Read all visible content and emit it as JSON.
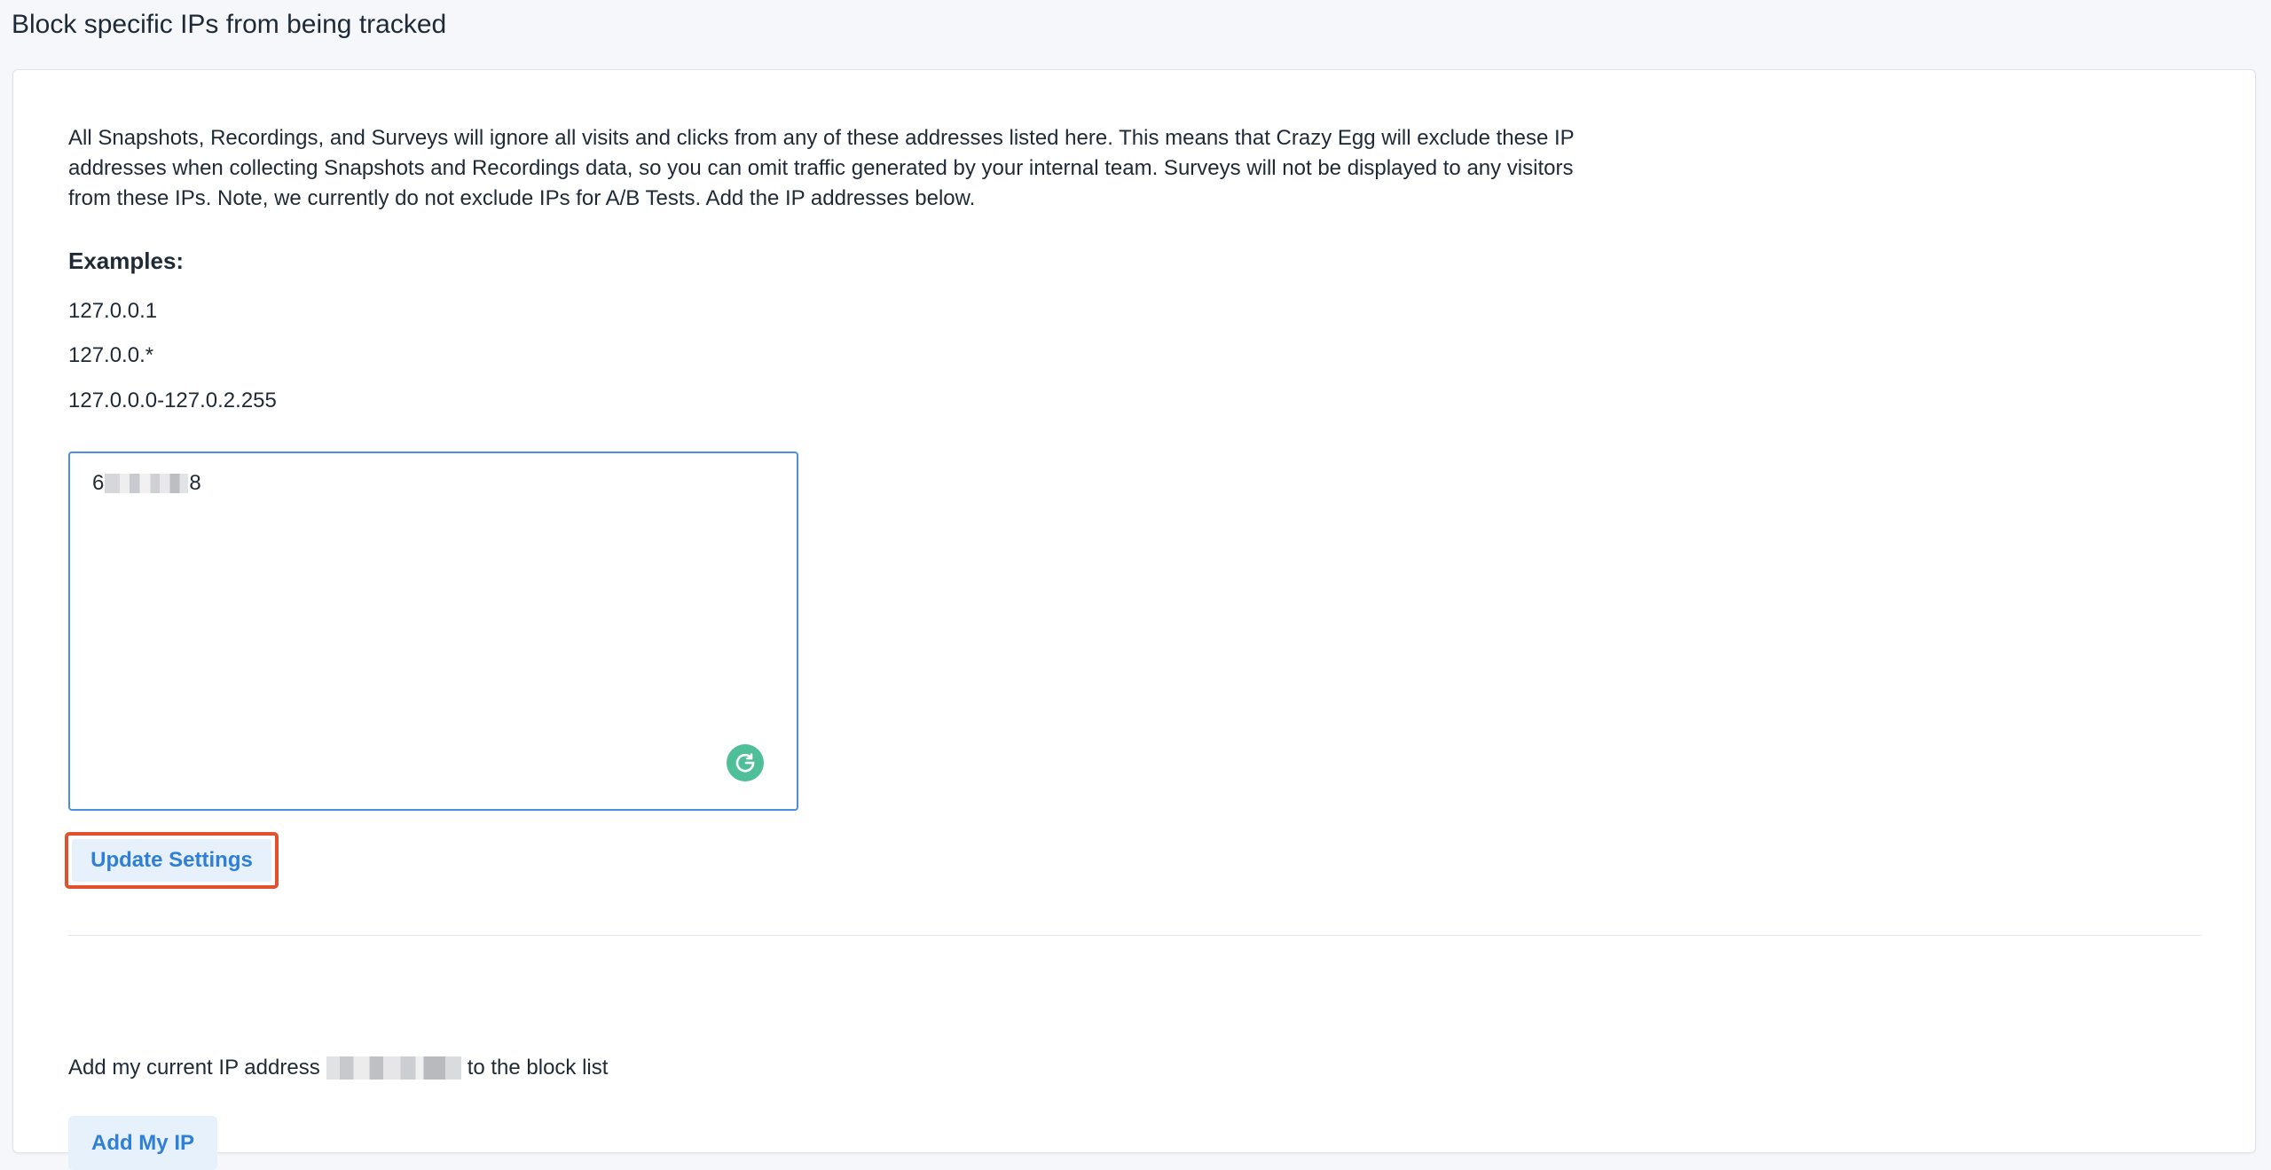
{
  "page": {
    "title": "Block specific IPs from being tracked"
  },
  "card": {
    "description": "All Snapshots, Recordings, and Surveys will ignore all visits and clicks from any of these addresses listed here. This means that Crazy Egg will exclude these IP addresses when collecting Snapshots and Recordings data, so you can omit traffic generated by your internal team. Surveys will not be displayed to any visitors from these IPs. Note, we currently do not exclude IPs for A/B Tests. Add the IP addresses below.",
    "examples_heading": "Examples:",
    "examples": [
      "127.0.0.1",
      "127.0.0.*",
      "127.0.0.0-127.0.2.255"
    ]
  },
  "ip_list": {
    "value_prefix": "6",
    "value_suffix": "8",
    "extension_icon": "grammarly-icon"
  },
  "buttons": {
    "update_label": "Update Settings",
    "add_my_ip_label": "Add My IP"
  },
  "current_ip": {
    "prefix": "Add my current IP address",
    "suffix": "to the block list"
  },
  "colors": {
    "accent": "#2f7ed8",
    "button_bg": "#e6f1fc",
    "highlight_border": "#e0512f",
    "input_border": "#4a90e2",
    "grammarly": "#4fbf9a"
  }
}
